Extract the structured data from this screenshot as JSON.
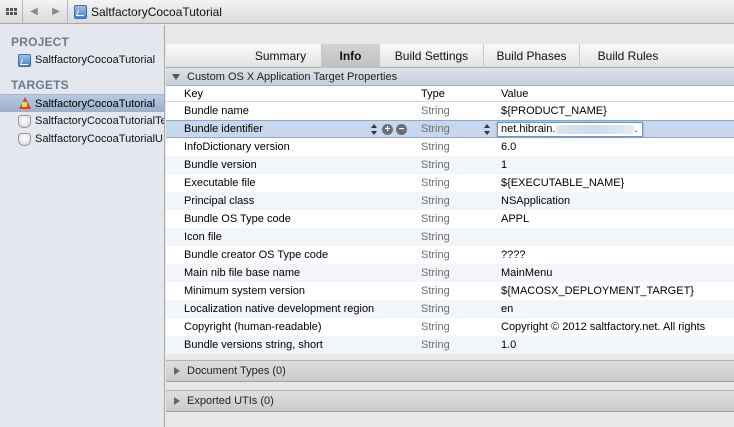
{
  "jumpbar": {
    "project": "SaltfactoryCocoaTutorial"
  },
  "sidebar": {
    "project_header": "PROJECT",
    "project_item": "SaltfactoryCocoaTutorial",
    "targets_header": "TARGETS",
    "targets": [
      {
        "label": "SaltfactoryCocoaTutorial",
        "icon": "app-icon",
        "selected": true
      },
      {
        "label": "SaltfactoryCocoaTutorialTests",
        "icon": "target-icon",
        "selected": false
      },
      {
        "label": "SaltfactoryCocoaTutorialUITests",
        "icon": "target-icon",
        "selected": false
      }
    ]
  },
  "tabs": [
    {
      "label": "Summary"
    },
    {
      "label": "Info",
      "active": true
    },
    {
      "label": "Build Settings"
    },
    {
      "label": "Build Phases"
    },
    {
      "label": "Build Rules"
    }
  ],
  "section": {
    "title": "Custom OS X Application Target Properties"
  },
  "table": {
    "headers": {
      "key": "Key",
      "type": "Type",
      "value": "Value"
    },
    "rows": [
      {
        "key": "Bundle name",
        "type": "String",
        "value": "${PRODUCT_NAME}"
      },
      {
        "key": "Bundle identifier",
        "type": "String",
        "value": "net.hibrain.",
        "value_suffix": ".",
        "selected": true
      },
      {
        "key": "InfoDictionary version",
        "type": "String",
        "value": "6.0"
      },
      {
        "key": "Bundle version",
        "type": "String",
        "value": "1"
      },
      {
        "key": "Executable file",
        "type": "String",
        "value": "${EXECUTABLE_NAME}"
      },
      {
        "key": "Principal class",
        "type": "String",
        "value": "NSApplication"
      },
      {
        "key": "Bundle OS Type code",
        "type": "String",
        "value": "APPL"
      },
      {
        "key": "Icon file",
        "type": "String",
        "value": ""
      },
      {
        "key": "Bundle creator OS Type code",
        "type": "String",
        "value": "????"
      },
      {
        "key": "Main nib file base name",
        "type": "String",
        "value": "MainMenu"
      },
      {
        "key": "Minimum system version",
        "type": "String",
        "value": "${MACOSX_DEPLOYMENT_TARGET}"
      },
      {
        "key": "Localization native development region",
        "type": "String",
        "value": "en"
      },
      {
        "key": "Copyright (human-readable)",
        "type": "String",
        "value": "Copyright © 2012 saltfactory.net. All rights"
      },
      {
        "key": "Bundle versions string, short",
        "type": "String",
        "value": "1.0"
      }
    ]
  },
  "collapsed_sections": [
    {
      "label": "Document Types (0)"
    },
    {
      "label": "Exported UTIs (0)"
    }
  ],
  "row_controls": {
    "add": "+",
    "remove": "−"
  }
}
